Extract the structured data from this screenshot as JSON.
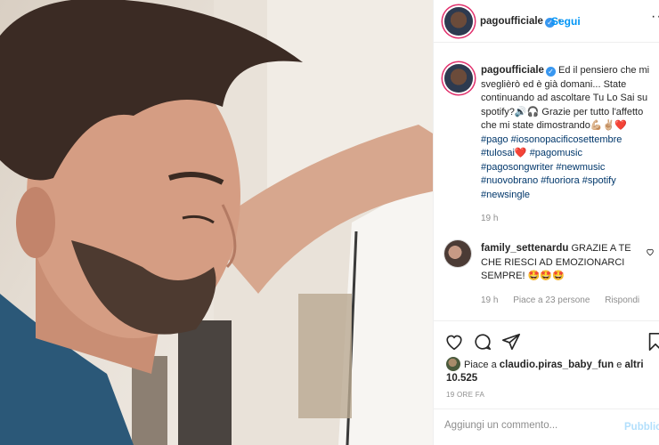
{
  "post": {
    "photo_icon": "person-portrait-photo"
  },
  "header": {
    "username": "pagoufficiale",
    "verified_icon": "verified-badge-icon",
    "separator": "•",
    "follow_label": "Segui",
    "more_label": "···"
  },
  "caption": {
    "username": "pagoufficiale",
    "text_1": "Ed il pensiero che mi sveglièrò ed è già domani... State continuando ad ascoltare Tu Lo Sai su spotify?",
    "emoji_1": "🔊🎧",
    "text_2": "Grazie per tutto l'affetto che mi state dimostrando",
    "emoji_2": "💪🏼✌🏼❤️",
    "hashtags": [
      "#pago",
      "#iosonopacificosettembre",
      "#tulosai",
      "#pagomusic",
      "#pagosongwriter",
      "#newmusic",
      "#nuovobrano",
      "#fuoriora",
      "#spotify",
      "#newsingle"
    ],
    "heart_after": "❤️",
    "time": "19 h"
  },
  "comment": {
    "username": "family_settenardu",
    "text": "GRAZIE A TE CHE RIESCI AD EMOZIONARCI SEMPRE!",
    "emoji": "🤩🤩🤩",
    "time": "19 h",
    "likes": "Piace a 23 persone",
    "reply": "Rispondi",
    "heart_icon": "heart-outline-icon"
  },
  "actions": {
    "like_icon": "heart-outline-icon",
    "comment_icon": "comment-icon",
    "share_icon": "paper-plane-icon",
    "save_icon": "bookmark-icon"
  },
  "likes": {
    "prefix": "Piace a ",
    "user": "claudio.piras_baby_fun",
    "middle": " e ",
    "others": "altri 10.525"
  },
  "date": "19 ORE FA",
  "add_comment": {
    "placeholder": "Aggiungi un commento...",
    "publish": "Pubblica"
  },
  "colors": {
    "link_blue": "#0095f6",
    "hashtag": "#00376b",
    "muted": "#8e8e8e",
    "verified": "#3897f0",
    "story_ring": "#e1306c"
  }
}
